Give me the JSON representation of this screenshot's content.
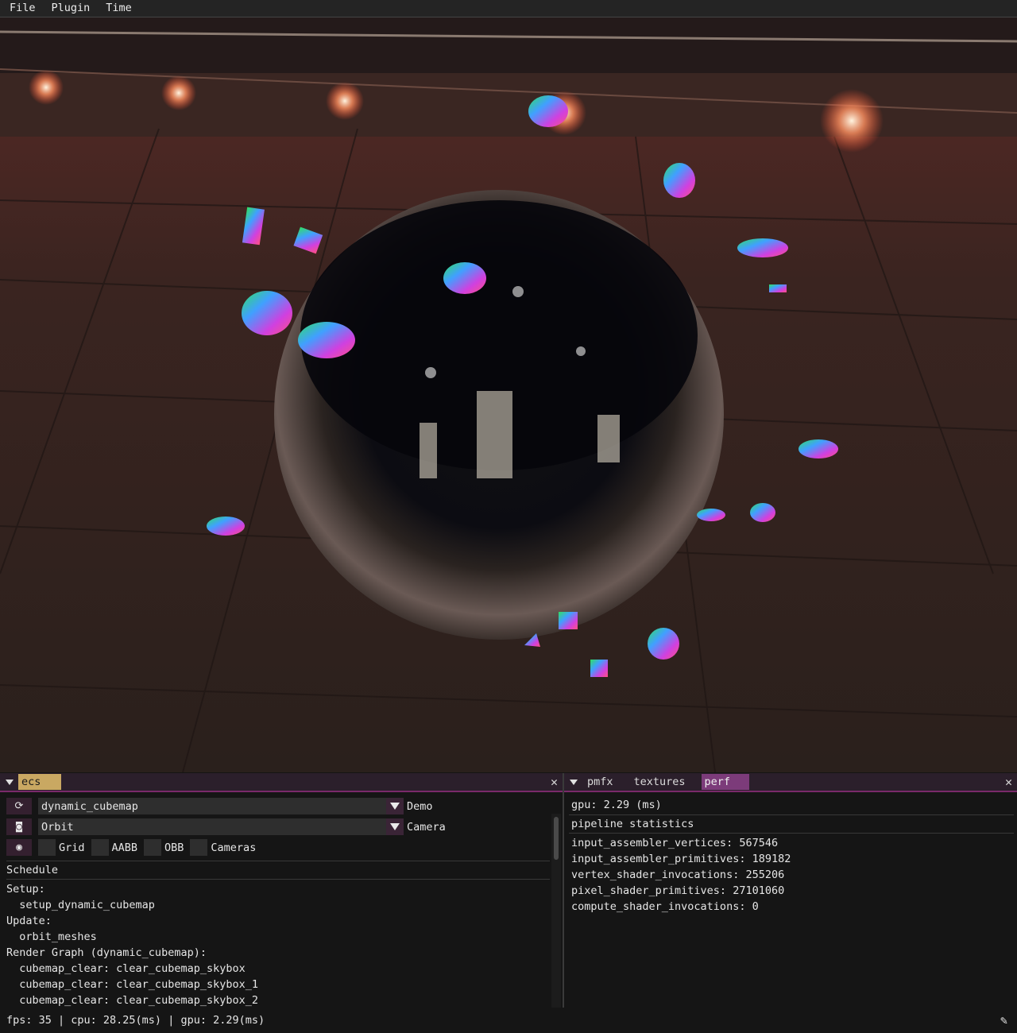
{
  "menu": [
    "File",
    "Plugin",
    "Time"
  ],
  "viewport": {
    "icon": "reflective-sphere-scene"
  },
  "ecs_panel": {
    "tab_label": "ecs",
    "close_icon": "close-icon",
    "demo_combo": {
      "value": "dynamic_cubemap",
      "label": "Demo",
      "icon": "refresh-icon"
    },
    "camera_combo": {
      "value": "Orbit",
      "label": "Camera",
      "icon": "camera-icon"
    },
    "visibility": {
      "icon": "eye-icon",
      "checks": [
        "Grid",
        "AABB",
        "OBB",
        "Cameras"
      ]
    },
    "schedule_title": "Schedule",
    "schedule_lines": [
      "Setup:",
      "  setup_dynamic_cubemap",
      "Update:",
      "  orbit_meshes",
      "Render Graph (dynamic_cubemap):",
      "  cubemap_clear: clear_cubemap_skybox",
      "  cubemap_clear: clear_cubemap_skybox_1",
      "  cubemap_clear: clear_cubemap_skybox_2"
    ]
  },
  "perf_panel": {
    "tabs": [
      "pmfx",
      "textures",
      "perf"
    ],
    "active_tab": "perf",
    "gpu_line": "gpu: 2.29 (ms)",
    "stats_title": "pipeline statistics",
    "stats": [
      "input_assembler_vertices: 567546",
      "input_assembler_primitives: 189182",
      "vertex_shader_invocations: 255206",
      "pixel_shader_primitives: 27101060",
      "compute_shader_invocations: 0"
    ]
  },
  "status": {
    "text": "fps: 35 | cpu: 28.25(ms) | gpu: 2.29(ms)",
    "icon": "pen-icon"
  }
}
